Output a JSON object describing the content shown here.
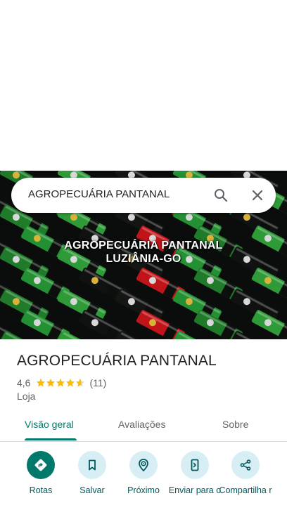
{
  "search": {
    "query": "AGROPECUÁRIA PANTANAL"
  },
  "hero": {
    "caption_line1": "AGROPECUÁRIA PANTANAL",
    "caption_line2": "LUZIÂNIA-GO"
  },
  "place": {
    "name": "AGROPECUÁRIA PANTANAL",
    "rating": "4,6",
    "rating_value": 4.6,
    "reviews": "(11)",
    "category": "Loja"
  },
  "tabs": [
    {
      "label": "Visão geral",
      "active": true
    },
    {
      "label": "Avaliações",
      "active": false
    },
    {
      "label": "Sobre",
      "active": false
    }
  ],
  "actions": [
    {
      "label": "Rotas",
      "icon": "directions-icon"
    },
    {
      "label": "Salvar",
      "icon": "bookmark-icon"
    },
    {
      "label": "Próximo",
      "icon": "nearby-icon"
    },
    {
      "label": "Enviar para o",
      "icon": "send-to-phone-icon"
    },
    {
      "label": "Compartilha r",
      "icon": "share-icon"
    }
  ],
  "colors": {
    "accent": "#00796b",
    "action_bg": "#d7eef4",
    "star": "#fbbc04"
  }
}
